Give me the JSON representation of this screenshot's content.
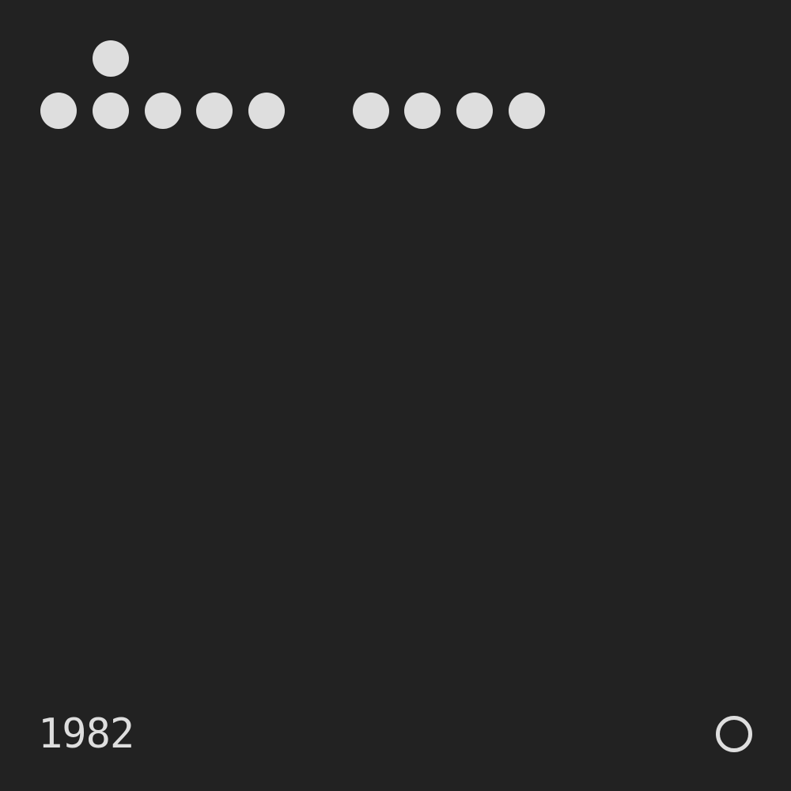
{
  "colors": {
    "background": "#222222",
    "foreground": "#dedede"
  },
  "footer": {
    "year": "1982"
  },
  "icons": {
    "corner": "ring-icon"
  }
}
